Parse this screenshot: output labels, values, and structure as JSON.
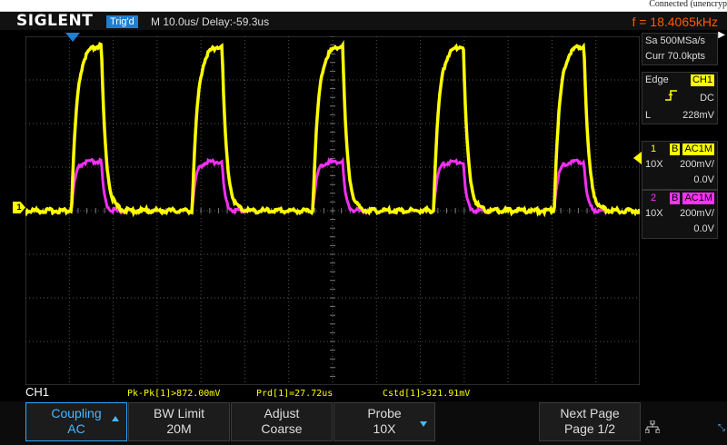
{
  "connection": {
    "status": "Connected (unencryp"
  },
  "header": {
    "brand": "SIGLENT",
    "trigger_status": "Trig'd",
    "timebase": "M 10.0us/  Delay:-59.3us",
    "frequency": "f = 18.4065kHz"
  },
  "acquisition": {
    "sample_rate": "Sa 500MSa/s",
    "memory_depth": "Curr 70.0kpts"
  },
  "trigger": {
    "type": "Edge",
    "source": "CH1",
    "slope_icon": "rising-edge-icon",
    "coupling": "DC",
    "level_prefix": "L",
    "level": "228mV"
  },
  "channels": [
    {
      "number": "1",
      "bw_flag": "B",
      "coupling": "AC1M",
      "probe": "10X",
      "scale": "200mV/",
      "offset": "0.0V",
      "color": "#ffff00"
    },
    {
      "number": "2",
      "bw_flag": "B",
      "coupling": "AC1M",
      "probe": "10X",
      "scale": "200mV/",
      "offset": "0.0V",
      "color": "#ff33ff"
    }
  ],
  "ch1_marker": "1",
  "active_channel_label": "CH1",
  "measurements": [
    "Pk-Pk[1]>872.00mV",
    "Prd[1]=27.72us",
    "Cstd[1]>321.91mV"
  ],
  "softkeys": [
    {
      "line1": "Coupling",
      "line2": "AC",
      "active": true,
      "arrow": "up"
    },
    {
      "line1": "BW Limit",
      "line2": "20M",
      "active": false
    },
    {
      "line1": "Adjust",
      "line2": "Coarse",
      "active": false
    },
    {
      "line1": "Probe",
      "line2": "10X",
      "active": false,
      "arrow": "down"
    },
    {
      "line1": "Next Page",
      "line2": "Page 1/2",
      "active": false
    }
  ],
  "icons": {
    "network": "network-icon"
  },
  "colors": {
    "ch1": "#ffff00",
    "ch2": "#ff33ff",
    "accent": "#1f7fd1",
    "frequency": "#ff5a00"
  },
  "waveform": {
    "period_us": 27.72,
    "pulse_starts_div": [
      1.05,
      3.8,
      6.55,
      9.3,
      12.05
    ]
  }
}
